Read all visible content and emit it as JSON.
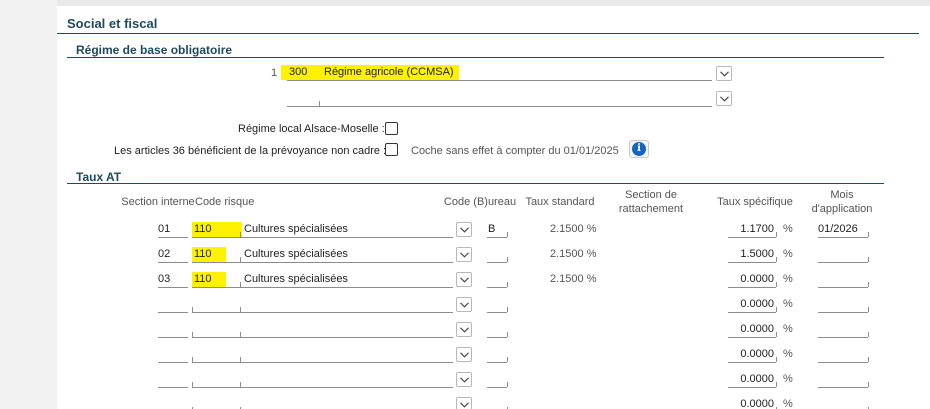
{
  "section_title": "Social et fiscal",
  "regime": {
    "title": "Régime de base obligatoire",
    "row1_index": "1",
    "row1_code": "300",
    "row1_label": "Régime agricole (CCMSA)",
    "row2_code": "",
    "row2_label": "",
    "alsace_label": "Régime local Alsace-Moselle :",
    "alsace_checked": false,
    "art36_label": "Les articles 36 bénéficient de la prévoyance non cadre :",
    "art36_checked": false,
    "art36_note": "Coche sans effet à compter du 01/01/2025"
  },
  "taux_at": {
    "title": "Taux AT",
    "headers": {
      "section_interne": "Section interne",
      "code_risque": "Code risque",
      "code_bureau": "Code (B)ureau",
      "taux_standard": "Taux standard",
      "section_rattachement": "Section de rattachement",
      "taux_specifique": "Taux spécifique",
      "mois_application": "Mois d'application"
    },
    "percent_sign": "%",
    "rows": [
      {
        "section": "01",
        "code": "110",
        "label": "Cultures spécialisées",
        "bureau": "B",
        "standard": "2.1500 %",
        "specifique": "1.1700",
        "mois": "01/2026"
      },
      {
        "section": "02",
        "code": "110",
        "label": "Cultures spécialisées",
        "bureau": "",
        "standard": "2.1500 %",
        "specifique": "1.5000",
        "mois": ""
      },
      {
        "section": "03",
        "code": "110",
        "label": "Cultures spécialisées",
        "bureau": "",
        "standard": "2.1500 %",
        "specifique": "0.0000",
        "mois": ""
      },
      {
        "section": "",
        "code": "",
        "label": "",
        "bureau": "",
        "standard": "",
        "specifique": "0.0000",
        "mois": ""
      },
      {
        "section": "",
        "code": "",
        "label": "",
        "bureau": "",
        "standard": "",
        "specifique": "0.0000",
        "mois": ""
      },
      {
        "section": "",
        "code": "",
        "label": "",
        "bureau": "",
        "standard": "",
        "specifique": "0.0000",
        "mois": ""
      },
      {
        "section": "",
        "code": "",
        "label": "",
        "bureau": "",
        "standard": "",
        "specifique": "0.0000",
        "mois": ""
      },
      {
        "section": "",
        "code": "",
        "label": "",
        "bureau": "",
        "standard": "",
        "specifique": "0.0000",
        "mois": ""
      }
    ]
  },
  "colors": {
    "highlight": "#fff200",
    "heading": "#1f4a5c",
    "info": "#1565c0"
  },
  "icons": {
    "dropdown": "chevron-down-icon",
    "info": "info-icon"
  }
}
